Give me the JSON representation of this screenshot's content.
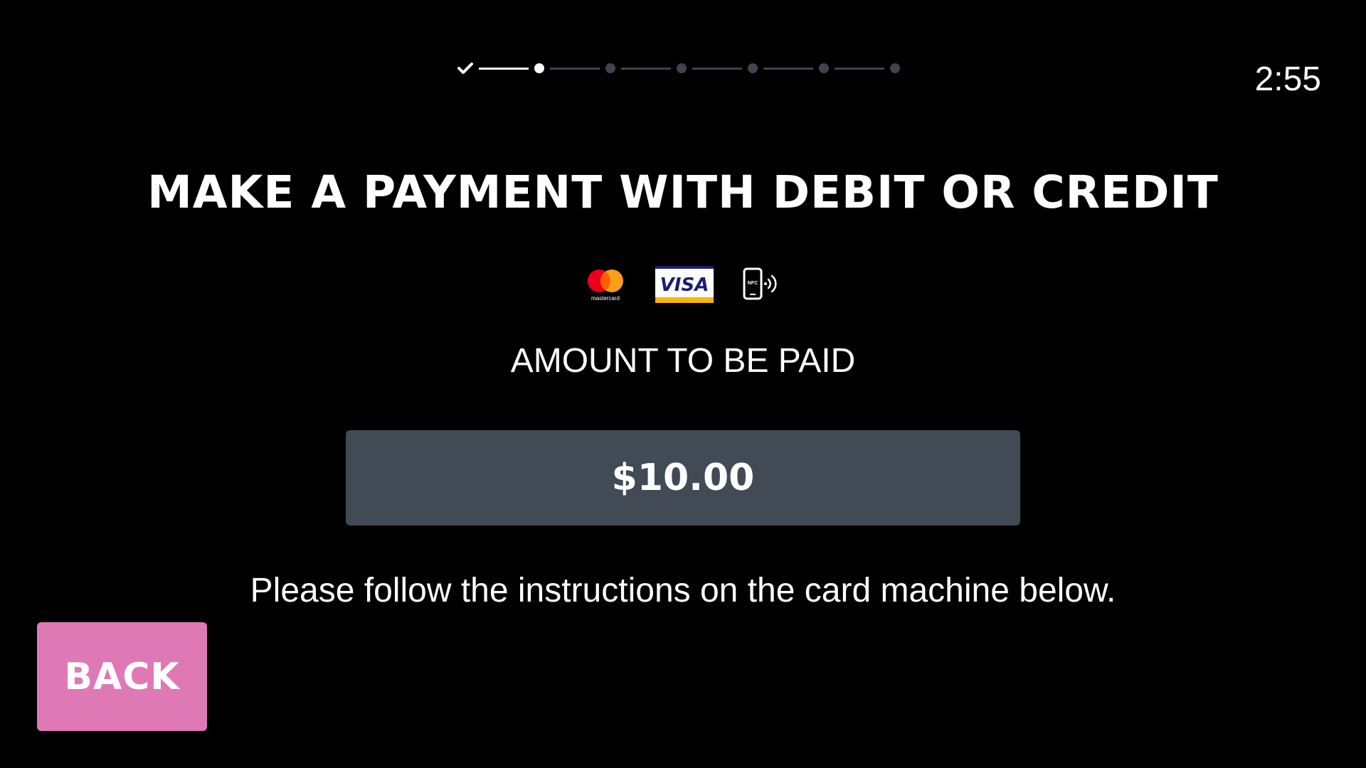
{
  "timer": {
    "text": "2:55"
  },
  "progress": {
    "total_steps": 7,
    "completed_steps": 1,
    "current_step": 2
  },
  "title": "MAKE A PAYMENT WITH DEBIT OR CREDIT",
  "payment_methods": {
    "mastercard_text": "mastercard",
    "visa_text": "VISA",
    "nfc_text": "NFC"
  },
  "amount": {
    "label": "AMOUNT TO BE PAID",
    "value": "$10.00"
  },
  "instruction": "Please follow the instructions on the card machine below.",
  "back_button": {
    "label": "BACK"
  },
  "colors": {
    "background": "#000000",
    "amount_box": "#424a55",
    "back_button": "#de79b6",
    "step_inactive": "#3e4550",
    "step_active": "#ffffff",
    "mastercard_red": "#eb001b",
    "mastercard_orange": "#f79e1b",
    "visa_blue": "#1a1f71",
    "visa_gold": "#f7b600"
  }
}
